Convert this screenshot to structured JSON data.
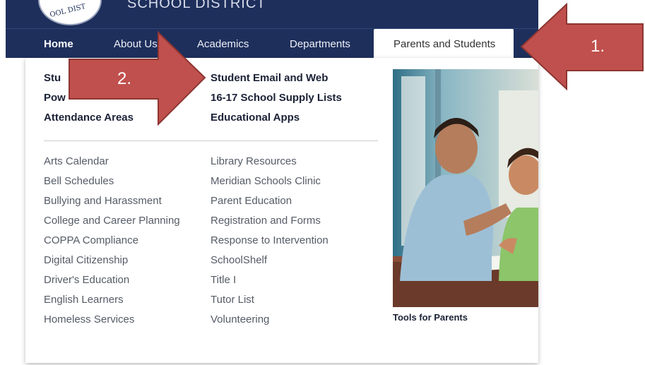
{
  "header": {
    "district_name": "SCHOOL DISTRICT",
    "logo_text": "OOL DIST"
  },
  "nav": {
    "items": [
      {
        "label": "Home"
      },
      {
        "label": "About Us"
      },
      {
        "label": "Academics"
      },
      {
        "label": "Departments"
      },
      {
        "label": "Parents and Students"
      }
    ]
  },
  "dropdown": {
    "featured_left": [
      "Stu",
      "Pow",
      "Attendance Areas"
    ],
    "featured_right": [
      "Student Email and Web",
      "16-17 School Supply Lists",
      "Educational Apps"
    ],
    "links_left": [
      "Arts Calendar",
      "Bell Schedules",
      "Bullying and Harassment",
      "College and Career Planning",
      "COPPA Compliance",
      "Digital Citizenship",
      "Driver's Education",
      "English Learners",
      "Homeless Services"
    ],
    "links_right": [
      "Library Resources",
      "Meridian Schools Clinic",
      "Parent Education",
      "Registration and Forms",
      "Response to Intervention",
      "SchoolShelf",
      "Title I",
      "Tutor List",
      "Volunteering"
    ],
    "promo_caption": "Tools for Parents"
  },
  "annotations": {
    "arrow1_label": "1.",
    "arrow2_label": "2."
  },
  "colors": {
    "nav_bg": "#1e2f5c",
    "arrow": "#c0504d",
    "arrow_border": "#8c3532"
  }
}
